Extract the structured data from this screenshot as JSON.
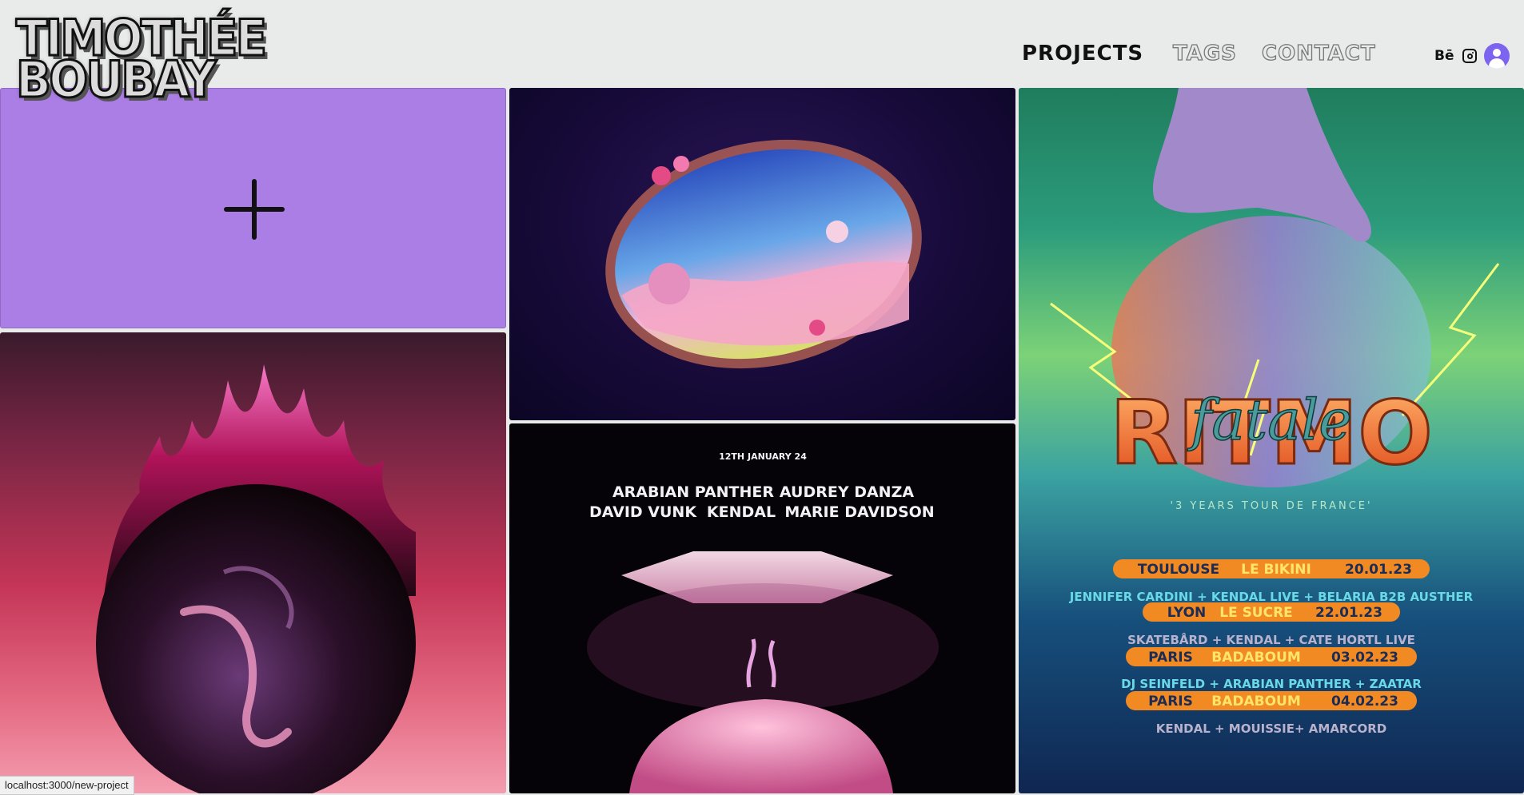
{
  "header": {
    "logo_line1": "TIMOTHÉE",
    "logo_line2": "BOUBAY",
    "nav": {
      "projects": "PROJECTS",
      "tags": "TAGS",
      "contact": "CONTACT"
    },
    "behance": "Bē",
    "icons": {
      "instagram": "instagram-icon",
      "avatar": "user-avatar-icon"
    }
  },
  "colors": {
    "background": "#e9eaea",
    "new_project_tile": "#ab7ee5",
    "avatar": "#7c63f0"
  },
  "gig_poster": {
    "date": "12TH JANUARY 24",
    "lineup_row1": [
      "ARABIAN PANTHER",
      "AUDREY DANZA"
    ],
    "lineup_row2": [
      "DAVID VUNK",
      "KENDAL",
      "MARIE DAVIDSON"
    ]
  },
  "ritmo_poster": {
    "title_back": "RITMO",
    "title_script": "fatale",
    "subtitle": "'3 YEARS TOUR DE FRANCE'",
    "dates": [
      {
        "city": "TOULOUSE",
        "venue": "LE BIKINI",
        "date": "20.01.23"
      },
      {
        "city": "LYON",
        "venue": "LE SUCRE",
        "date": "22.01.23"
      },
      {
        "city": "PARIS",
        "venue": "BADABOUM",
        "date": "03.02.23"
      },
      {
        "city": "PARIS",
        "venue": "BADABOUM",
        "date": "04.02.23"
      }
    ],
    "lineups": [
      "JENNIFER CARDINI + KENDAL LIVE + BELARIA B2B AUSTHER",
      "SKATEBÅRD + KENDAL + CATE HORTL LIVE",
      "DJ SEINFELD + ARABIAN PANTHER + ZAATAR",
      "KENDAL + MOUISSIE+ AMARCORD"
    ]
  },
  "status_bar": {
    "url": "localhost:3000/new-project"
  }
}
